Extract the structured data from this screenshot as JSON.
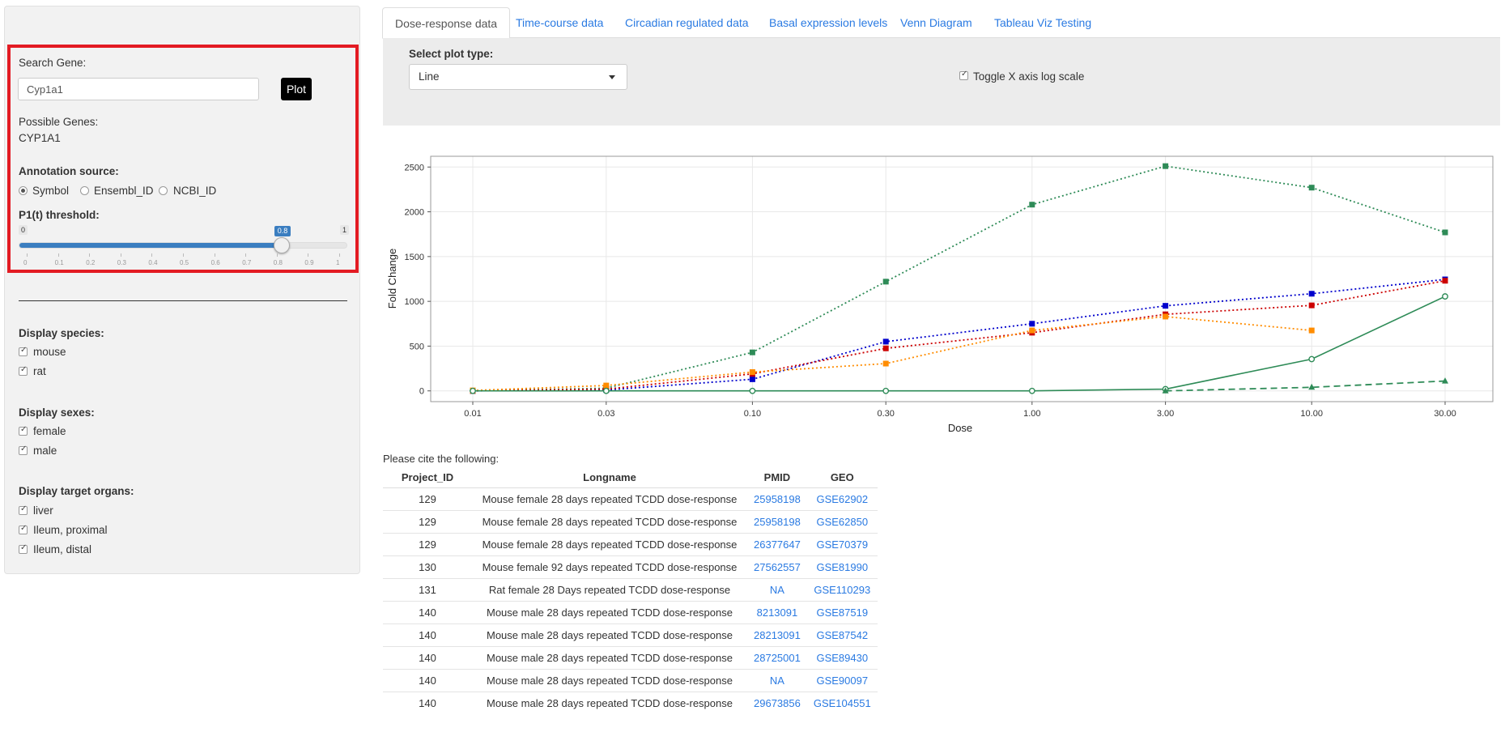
{
  "sidebar": {
    "search_label": "Search Gene:",
    "search_value": "Cyp1a1",
    "plot_button": "Plot",
    "possible_label": "Possible Genes:",
    "possible_value": "CYP1A1",
    "annotation_label": "Annotation source:",
    "annotation_options": [
      "Symbol",
      "Ensembl_ID",
      "NCBI_ID"
    ],
    "annotation_selected": "Symbol",
    "threshold_label": "P1(t) threshold:",
    "slider": {
      "min": "0",
      "max": "1",
      "value": "0.8",
      "value_num": 0.8,
      "ticks": [
        "0",
        "0.1",
        "0.2",
        "0.3",
        "0.4",
        "0.5",
        "0.6",
        "0.7",
        "0.8",
        "0.9",
        "1"
      ]
    },
    "species_label": "Display species:",
    "species": [
      "mouse",
      "rat"
    ],
    "sexes_label": "Display sexes:",
    "sexes": [
      "female",
      "male"
    ],
    "organs_label": "Display target organs:",
    "organs": [
      "liver",
      "Ileum, proximal",
      "Ileum, distal"
    ]
  },
  "tabs": [
    "Dose-response data",
    "Time-course data",
    "Circadian regulated data",
    "Basal expression levels",
    "Venn Diagram",
    "Tableau Viz Testing"
  ],
  "controls": {
    "plot_type_label": "Select plot type:",
    "plot_type_value": "Line",
    "log_toggle_label": "Toggle X axis log scale",
    "log_checked": true
  },
  "chart_data": {
    "type": "line",
    "xlabel": "Dose",
    "ylabel": "Fold Change",
    "x_scale": "log",
    "x_ticks": [
      "0.01",
      "0.03",
      "0.10",
      "0.30",
      "1.00",
      "3.00",
      "10.00",
      "30.00"
    ],
    "y_ticks": [
      "0",
      "500",
      "1000",
      "1500",
      "2000",
      "2500"
    ],
    "ylim": [
      -120,
      2620
    ],
    "grid": true,
    "series": [
      {
        "color": "#2e8b57",
        "dash": "dotted",
        "marker": "square",
        "x": [
          0.01,
          0.03,
          0.1,
          0.3,
          1,
          3,
          10,
          30
        ],
        "y": [
          0,
          30,
          430,
          1220,
          2080,
          2510,
          2270,
          1770
        ]
      },
      {
        "color": "#0000cc",
        "dash": "dotted",
        "marker": "square",
        "x": [
          0.01,
          0.03,
          0.1,
          0.3,
          1,
          3,
          10,
          30
        ],
        "y": [
          0,
          10,
          130,
          550,
          750,
          950,
          1085,
          1245
        ]
      },
      {
        "color": "#cc0000",
        "dash": "dotted",
        "marker": "square",
        "x": [
          0.01,
          0.03,
          0.1,
          0.3,
          1,
          3,
          10,
          30
        ],
        "y": [
          0,
          20,
          190,
          475,
          650,
          855,
          955,
          1230
        ]
      },
      {
        "color": "#ff8c00",
        "dash": "dotted",
        "marker": "square",
        "x": [
          0.01,
          0.03,
          0.1,
          0.3,
          1,
          3,
          10
        ],
        "y": [
          5,
          60,
          210,
          305,
          675,
          830,
          675
        ]
      },
      {
        "color": "#2e8b57",
        "dash": "solid",
        "marker": "circle",
        "x": [
          0.01,
          0.03,
          0.1,
          0.3,
          1,
          3,
          10,
          30
        ],
        "y": [
          0,
          0,
          0,
          0,
          0,
          20,
          355,
          1055
        ]
      },
      {
        "color": "#2e8b57",
        "dash": "dashed",
        "marker": "triangle",
        "x": [
          3,
          10,
          30
        ],
        "y": [
          0,
          40,
          110
        ]
      }
    ]
  },
  "citation": {
    "text": "Please cite the following:",
    "headers": [
      "Project_ID",
      "Longname",
      "PMID",
      "GEO"
    ],
    "rows": [
      [
        "129",
        "Mouse female 28 days repeated TCDD dose-response",
        "25958198",
        "GSE62902"
      ],
      [
        "129",
        "Mouse female 28 days repeated TCDD dose-response",
        "25958198",
        "GSE62850"
      ],
      [
        "129",
        "Mouse female 28 days repeated TCDD dose-response",
        "26377647",
        "GSE70379"
      ],
      [
        "130",
        "Mouse female 92 days repeated TCDD dose-response",
        "27562557",
        "GSE81990"
      ],
      [
        "131",
        "Rat female 28 Days repeated TCDD dose-response",
        "NA",
        "GSE110293"
      ],
      [
        "140",
        "Mouse male 28 days repeated TCDD dose-response",
        "8213091",
        "GSE87519"
      ],
      [
        "140",
        "Mouse male 28 days repeated TCDD dose-response",
        "28213091",
        "GSE87542"
      ],
      [
        "140",
        "Mouse male 28 days repeated TCDD dose-response",
        "28725001",
        "GSE89430"
      ],
      [
        "140",
        "Mouse male 28 days repeated TCDD dose-response",
        "NA",
        "GSE90097"
      ],
      [
        "140",
        "Mouse male 28 days repeated TCDD dose-response",
        "29673856",
        "GSE104551"
      ]
    ]
  },
  "colors": {
    "accent": "#2a7ae2",
    "highlight": "#e31b23",
    "slider": "#3b7ec0"
  }
}
